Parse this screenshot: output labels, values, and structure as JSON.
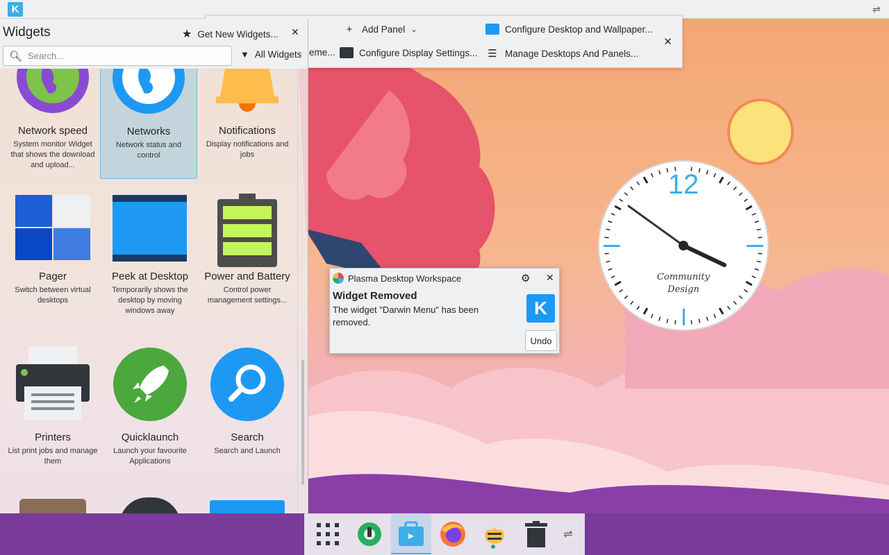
{
  "top_panel": {
    "launcher_label": "K"
  },
  "toolbar": {
    "add_panel": "Add Panel",
    "configure_desktop": "Configure Desktop and Wallpaper...",
    "theme_partial": "eme...",
    "configure_display": "Configure Display Settings...",
    "manage_desktops": "Manage Desktops And Panels...",
    "close_icon": "close-icon"
  },
  "widgets": {
    "title": "Widgets",
    "get_new": "Get New Widgets...",
    "search_placeholder": "Search...",
    "filter_label": "All Widgets",
    "items": [
      {
        "name": "Network speed",
        "desc": "System monitor Widget that shows the download and upload...",
        "icon": "network-speed-icon"
      },
      {
        "name": "Networks",
        "desc": "Network status and control",
        "icon": "networks-icon",
        "selected": true
      },
      {
        "name": "Notifications",
        "desc": "Display notifications and jobs",
        "icon": "bell-icon"
      },
      {
        "name": "Pager",
        "desc": "Switch between virtual desktops",
        "icon": "pager-icon"
      },
      {
        "name": "Peek at Desktop",
        "desc": "Temporarily shows the desktop by moving windows away",
        "icon": "peek-desktop-icon"
      },
      {
        "name": "Power and Battery",
        "desc": "Control power management settings...",
        "icon": "battery-icon"
      },
      {
        "name": "Printers",
        "desc": "List print jobs and manage them",
        "icon": "printer-icon"
      },
      {
        "name": "Quicklaunch",
        "desc": "Launch your favourite Applications",
        "icon": "rocket-icon"
      },
      {
        "name": "Search",
        "desc": "Search and Launch",
        "icon": "search-icon"
      }
    ]
  },
  "notification": {
    "app_name": "Plasma Desktop Workspace",
    "title": "Widget Removed",
    "body": "The widget \"Darwin Menu\" has been removed.",
    "undo_label": "Undo",
    "kde_label": "K"
  },
  "clock": {
    "label_12": "12",
    "brand_line1": "Community",
    "brand_line2": "Design"
  },
  "taskbar": {
    "items": [
      "app-grid-icon",
      "system-settings-icon",
      "discover-icon",
      "firefox-icon",
      "kbugbuster-icon",
      "trash-icon",
      "panel-config-icon"
    ]
  }
}
